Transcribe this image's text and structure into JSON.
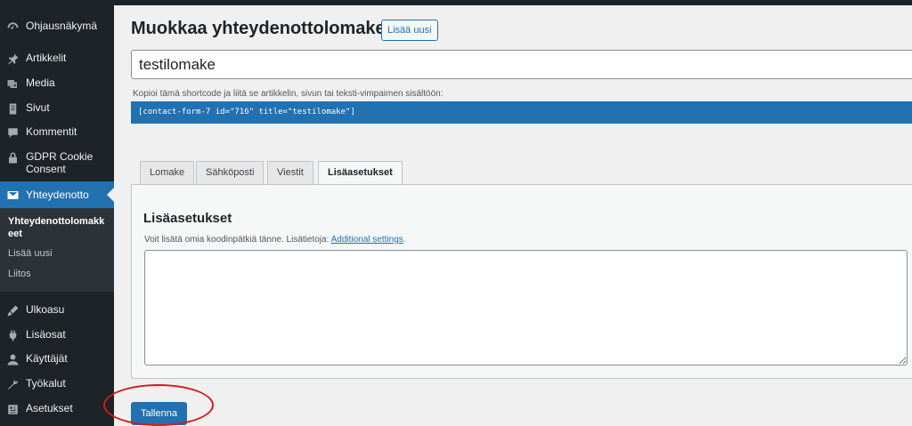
{
  "sidebar": {
    "items": [
      {
        "label": "Ohjausnäkymä",
        "icon": "dashboard-icon"
      },
      {
        "label": "Artikkelit",
        "icon": "pin-icon"
      },
      {
        "label": "Media",
        "icon": "media-icon"
      },
      {
        "label": "Sivut",
        "icon": "pages-icon"
      },
      {
        "label": "Kommentit",
        "icon": "comments-icon"
      },
      {
        "label": "GDPR Cookie Consent",
        "icon": "lock-icon"
      },
      {
        "label": "Yhteydenotto",
        "icon": "mail-icon",
        "active": true
      },
      {
        "label": "Ulkoasu",
        "icon": "appearance-icon"
      },
      {
        "label": "Lisäosat",
        "icon": "plugins-icon"
      },
      {
        "label": "Käyttäjät",
        "icon": "users-icon"
      },
      {
        "label": "Työkalut",
        "icon": "tools-icon"
      },
      {
        "label": "Asetukset",
        "icon": "settings-icon"
      }
    ],
    "submenu": [
      {
        "label": "Yhteydenottolomakkeet",
        "current": true
      },
      {
        "label": "Lisää uusi"
      },
      {
        "label": "Liitos"
      }
    ]
  },
  "header": {
    "title": "Muokkaa yhteydenottolomaketta",
    "add_new_label": "Lisää uusi"
  },
  "form": {
    "title_value": "testilomake",
    "shortcode_hint": "Kopioi tämä shortcode ja liitä se artikkelin, sivun tai teksti-vimpaimen sisältöön:",
    "shortcode": "[contact-form-7 id=\"716\" title=\"testilomake\"]"
  },
  "tabs": [
    {
      "label": "Lomake"
    },
    {
      "label": "Sähköposti"
    },
    {
      "label": "Viestit"
    },
    {
      "label": "Lisäasetukset",
      "active": true
    }
  ],
  "panel": {
    "heading": "Lisäasetukset",
    "description": "Voit lisätä omia koodinpätkiä tänne. Lisätietoja:",
    "link_label": "Additional settings",
    "link_suffix": ".",
    "textarea_value": ""
  },
  "actions": {
    "save_label": "Tallenna"
  },
  "colors": {
    "sidebar_bg": "#1d2327",
    "accent": "#2271b1",
    "annotation": "#d41a1a"
  }
}
